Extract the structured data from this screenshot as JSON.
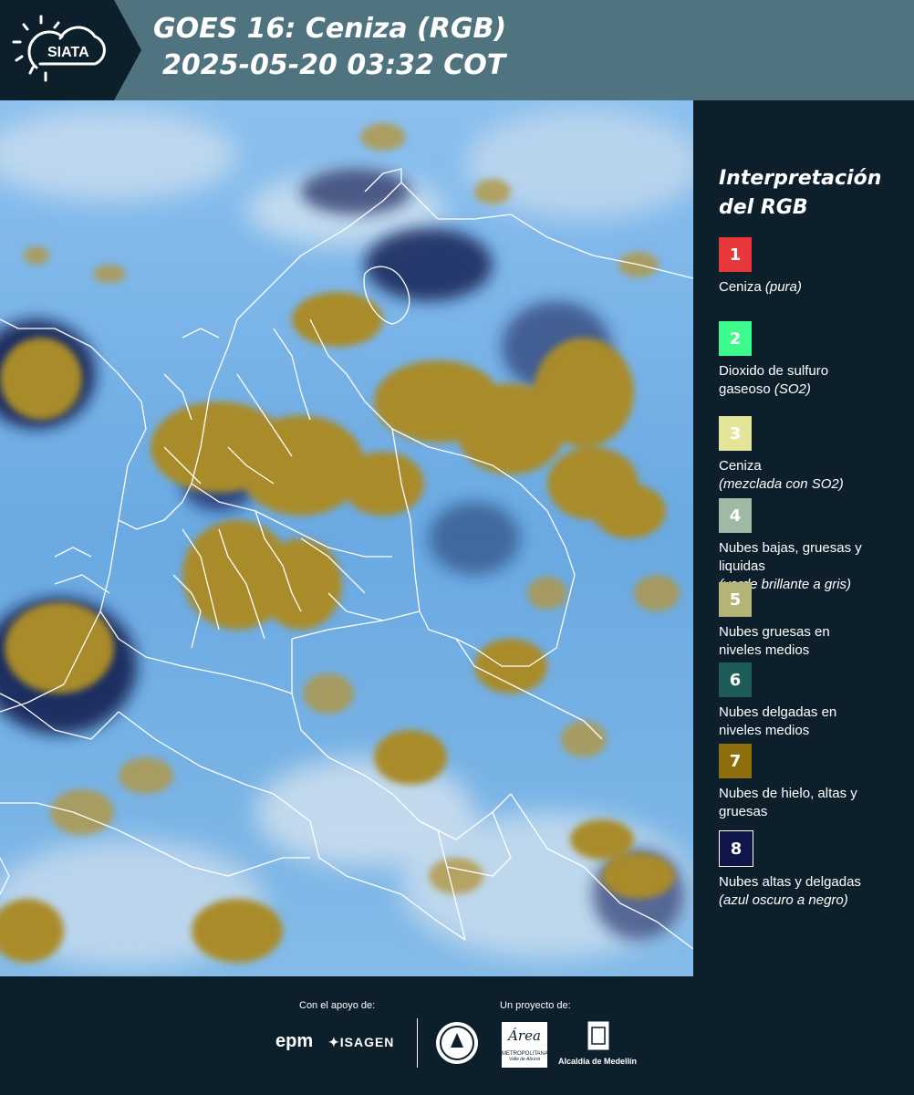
{
  "header": {
    "logo_text": "SIATA",
    "title_line1": "GOES 16: Ceniza (RGB)",
    "title_line2": "2025-05-20 03:32 COT"
  },
  "legend": {
    "title_line1": "Interpretación",
    "title_line2": "del RGB",
    "items": [
      {
        "number": "1",
        "color": "#e8373a",
        "text_color": "#ffffff",
        "label_lines": [
          "Ceniza "
        ],
        "note": "(pura)",
        "note_inline": true
      },
      {
        "number": "2",
        "color": "#3dfa8c",
        "text_color": "#ffffff",
        "label_lines": [
          "Dioxido de sulfuro",
          "gaseoso "
        ],
        "note": "(SO2)",
        "note_inline": true
      },
      {
        "number": "3",
        "color": "#e5e59a",
        "text_color": "#ffffff",
        "label_lines": [
          "Ceniza"
        ],
        "note": "(mezclada con SO2)",
        "note_inline": false
      },
      {
        "number": "4",
        "color": "#9fb9a4",
        "text_color": "#ffffff",
        "label_lines": [
          "Nubes bajas, gruesas y",
          "liquidas"
        ],
        "note": "(verde brillante a gris)",
        "note_inline": false
      },
      {
        "number": "5",
        "color": "#b3b476",
        "text_color": "#ffffff",
        "label_lines": [
          "Nubes gruesas en",
          "niveles medios"
        ],
        "note": "",
        "note_inline": false
      },
      {
        "number": "6",
        "color": "#1d5d56",
        "text_color": "#ffffff",
        "label_lines": [
          "Nubes delgadas en",
          "niveles medios"
        ],
        "note": "",
        "note_inline": false
      },
      {
        "number": "7",
        "color": "#8e6d0c",
        "text_color": "#ffffff",
        "label_lines": [
          "Nubes de hielo, altas y",
          "gruesas"
        ],
        "note": "",
        "note_inline": false
      },
      {
        "number": "8",
        "color": "#10154a",
        "text_color": "#ffffff",
        "label_lines": [
          "Nubes altas y delgadas"
        ],
        "note": "(azul oscuro a negro)",
        "note_inline": false
      }
    ]
  },
  "footer": {
    "support_caption": "Con el apoyo de:",
    "project_caption": "Un proyecto de:",
    "sponsor_1": "epm",
    "sponsor_2": "ISAGEN",
    "partner_1": "Área",
    "partner_1_sub": "METROPOLITANA",
    "partner_1_sub2": "Valle de Aburrá",
    "partner_2": "Alcaldía de Medellín"
  },
  "colors": {
    "header_bg": "#4f7480",
    "logo_bg": "#0d1f2b",
    "page_bg": "#0d1f2b",
    "sky_blue": "#7fb6e8",
    "ice_cloud": "#a88a2a",
    "border_lines": "#ffffff"
  }
}
